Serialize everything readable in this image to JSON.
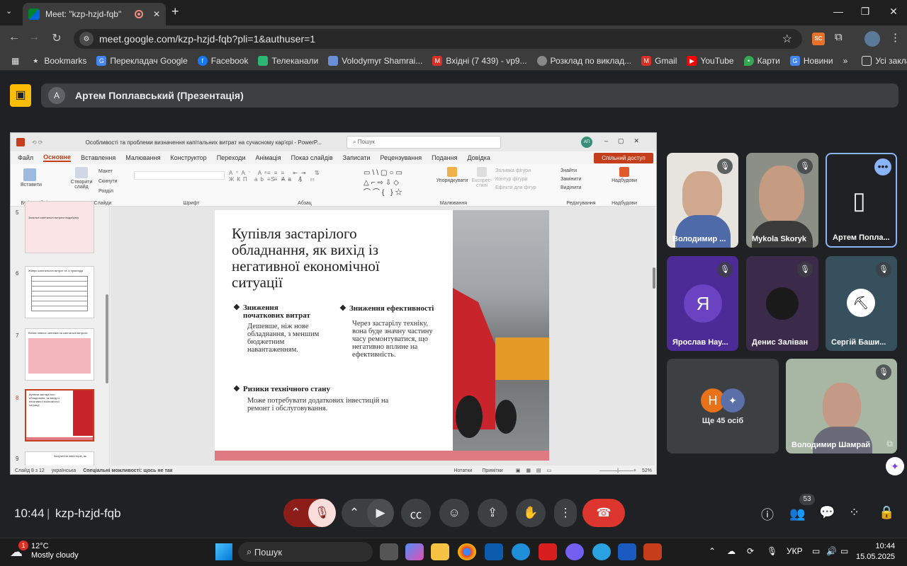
{
  "browser": {
    "tab_title": "Meet: \"kzp-hzjd-fqb\"",
    "url": "meet.google.com/kzp-hzjd-fqb?pli=1&authuser=1",
    "bookmarks": [
      "Bookmarks",
      "Перекладач Google",
      "Facebook",
      "Телеканали",
      "Volodymyr Shamrai...",
      "Вхідні (7 439) - vp9...",
      "Розклад по виклад...",
      "Gmail",
      "YouTube",
      "Карти",
      "Новини"
    ],
    "all_bookmarks": "Усі закладки",
    "ext_sc": "SC"
  },
  "meet": {
    "presenter_initial": "A",
    "presenter_label": "Артем Поплавський (Презентація)",
    "time": "10:44",
    "code": "kzp-hzjd-fqb",
    "participants_count": "53",
    "tiles": [
      {
        "name": "Володимир ..."
      },
      {
        "name": "Mykola Skoryk"
      },
      {
        "name": "Артем Попла..."
      },
      {
        "name": "Ярослав Нау...",
        "initial": "Я"
      },
      {
        "name": "Денис Заліван"
      },
      {
        "name": "Сергій Баши..."
      },
      {
        "name": "Ще 45 осіб",
        "initial": "Н"
      },
      {
        "name": "Володимир Шамрай"
      }
    ]
  },
  "ppt": {
    "title": "Особливості та проблеми визначення капітальних витрат на сучасному кар'єрі - PowerP...",
    "search": "Пошук",
    "user_initials": "АП",
    "menu": [
      "Файл",
      "Основне",
      "Вставлення",
      "Малювання",
      "Конструктор",
      "Переходи",
      "Анімація",
      "Показ слайдів",
      "Записати",
      "Рецензування",
      "Подання",
      "Довідка"
    ],
    "share": "Спільний доступ",
    "groups": [
      "Буфер обміну",
      "Слайди",
      "Шрифт",
      "Абзац",
      "Малювання",
      "Редагування",
      "Надбудови"
    ],
    "ribbon": {
      "paste": "Вставити",
      "new_slide": "Створити слайд",
      "layout": "Макет",
      "reset": "Скинути",
      "section": "Розділ",
      "arrange": "Упорядкувати",
      "quick_styles": "Експрес-стилі",
      "fill": "Заливка фігури",
      "outline": "Контур фігури",
      "effects": "Ефекти для фігур",
      "find": "Знайти",
      "replace": "Замінити",
      "select": "Виділити",
      "addins": "Надбудови"
    },
    "thumbs": [
      {
        "num": "5",
        "title": "Загальні капітальні витрати видобутку"
      },
      {
        "num": "6",
        "title": "Жанри капітальних витрат та їх приклади"
      },
      {
        "num": "7",
        "title": "Вплив певних чинників на капітальні витрати"
      },
      {
        "num": "8",
        "title": "Купівля застарілого обладнання, як вихід із негативної економічної ситуації"
      },
      {
        "num": "9",
        "title": "Залучення інвесторів, як"
      }
    ],
    "slide": {
      "title": "Купівля застарілого обладнання, як вихід із негативної економічної ситуації",
      "b1_head": "Зниження початкових витрат",
      "b1_body": "Дешевше, ніж нове обладнання, з меншим бюджетним навантаженням.",
      "b2_head": "Зниження ефективності",
      "b2_body": "Через застарілу техніку, вона буде значну частину часу ремонтуватися, що негативно вплине на ефективність.",
      "b3_head": "Ризики технічного стану",
      "b3_body": "Може потребувати додаткових інвестицій на ремонт і обслуговування."
    },
    "status": {
      "slide_of": "Слайд 8 з 12",
      "lang": "українська",
      "access": "Спеціальні можливості: щось не так",
      "notes": "Нотатки",
      "comments": "Примітки",
      "zoom": "52%"
    }
  },
  "taskbar": {
    "temp": "12°C",
    "weather": "Mostly cloudy",
    "weather_badge": "1",
    "search": "Пошук",
    "lang": "УКР",
    "time": "10:44",
    "date": "15.05.2025"
  }
}
